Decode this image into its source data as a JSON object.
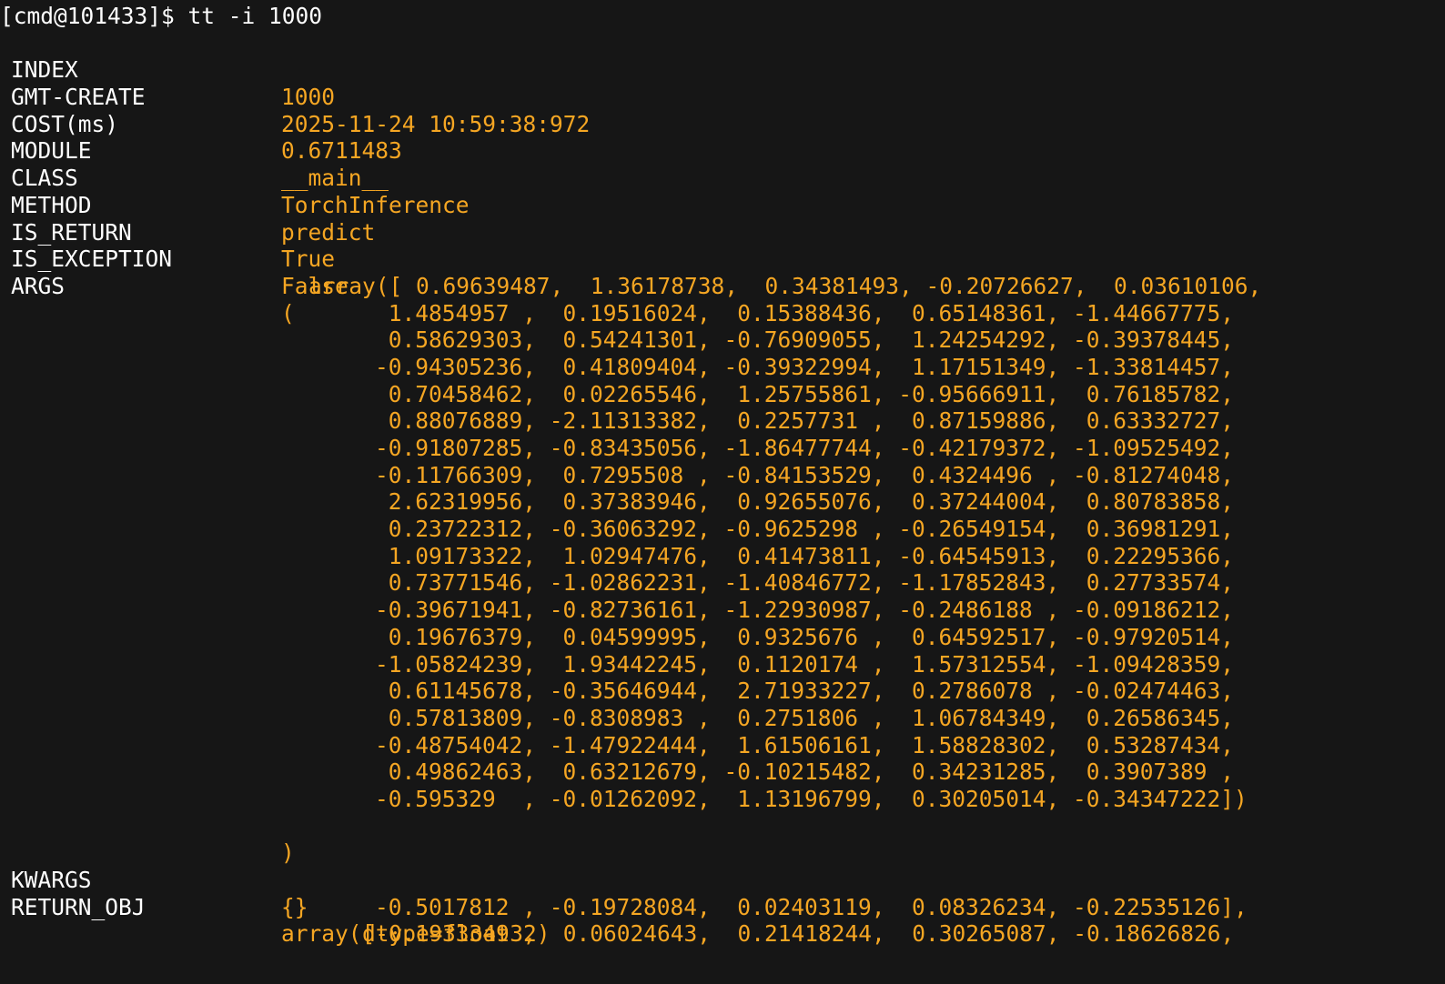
{
  "prompt": "[cmd@101433]$ tt -i 1000",
  "fields": {
    "index": {
      "key": "INDEX",
      "value": "1000"
    },
    "gmt_create": {
      "key": "GMT-CREATE",
      "value": "2025-11-24 10:59:38:972"
    },
    "cost": {
      "key": "COST(ms)",
      "value": "0.6711483"
    },
    "module": {
      "key": "MODULE",
      "value": "__main__"
    },
    "class": {
      "key": "CLASS",
      "value": "TorchInference"
    },
    "method": {
      "key": "METHOD",
      "value": "predict"
    },
    "is_return": {
      "key": "IS_RETURN",
      "value": "True"
    },
    "is_exception": {
      "key": "IS_EXCEPTION",
      "value": "False"
    },
    "args": {
      "key": "ARGS",
      "open": "(",
      "close": ")"
    },
    "kwargs": {
      "key": "KWARGS",
      "value": "{}"
    },
    "return_obj": {
      "key": "RETURN_OBJ"
    }
  },
  "args_array_lines": [
    "array([ 0.69639487,  1.36178738,  0.34381493, -0.20726627,  0.03610106,",
    " 1.4854957 ,  0.19516024,  0.15388436,  0.65148361, -1.44667775,",
    " 0.58629303,  0.54241301, -0.76909055,  1.24254292, -0.39378445,",
    "-0.94305236,  0.41809404, -0.39322994,  1.17151349, -1.33814457,",
    " 0.70458462,  0.02265546,  1.25755861, -0.95666911,  0.76185782,",
    " 0.88076889, -2.11313382,  0.2257731 ,  0.87159886,  0.63332727,",
    "-0.91807285, -0.83435056, -1.86477744, -0.42179372, -1.09525492,",
    "-0.11766309,  0.7295508 , -0.84153529,  0.4324496 , -0.81274048,",
    " 2.62319956,  0.37383946,  0.92655076,  0.37244004,  0.80783858,",
    " 0.23722312, -0.36063292, -0.9625298 , -0.26549154,  0.36981291,",
    " 1.09173322,  1.02947476,  0.41473811, -0.64545913,  0.22295366,",
    " 0.73771546, -1.02862231, -1.40846772, -1.17852843,  0.27733574,",
    "-0.39671941, -0.82736161, -1.22930987, -0.2486188 , -0.09186212,",
    " 0.19676379,  0.04599995,  0.9325676 ,  0.64592517, -0.97920514,",
    "-1.05824239,  1.93442245,  0.1120174 ,  1.57312554, -1.09428359,",
    " 0.61145678, -0.35646944,  2.71933227,  0.2786078 , -0.02474463,",
    " 0.57813809, -0.8308983 ,  0.2751806 ,  1.06784349,  0.26586345,",
    "-0.48754042, -1.47922444,  1.61506161,  1.58828302,  0.53287434,",
    " 0.49862463,  0.63212679, -0.10215482,  0.34231285,  0.3907389 ,",
    "-0.595329  , -0.01262092,  1.13196799,  0.30205014, -0.34347222])"
  ],
  "return_lines": [
    "array([-0.1933349 ,  0.06024643,  0.21418244,  0.30265087, -0.18626826,",
    "-0.5017812 , -0.19728084,  0.02403119,  0.08326234, -0.22535126],",
    "dtype=float32)"
  ],
  "colors": {
    "background": "#161616",
    "key_text": "#ffffff",
    "value_text": "#f5a623"
  }
}
